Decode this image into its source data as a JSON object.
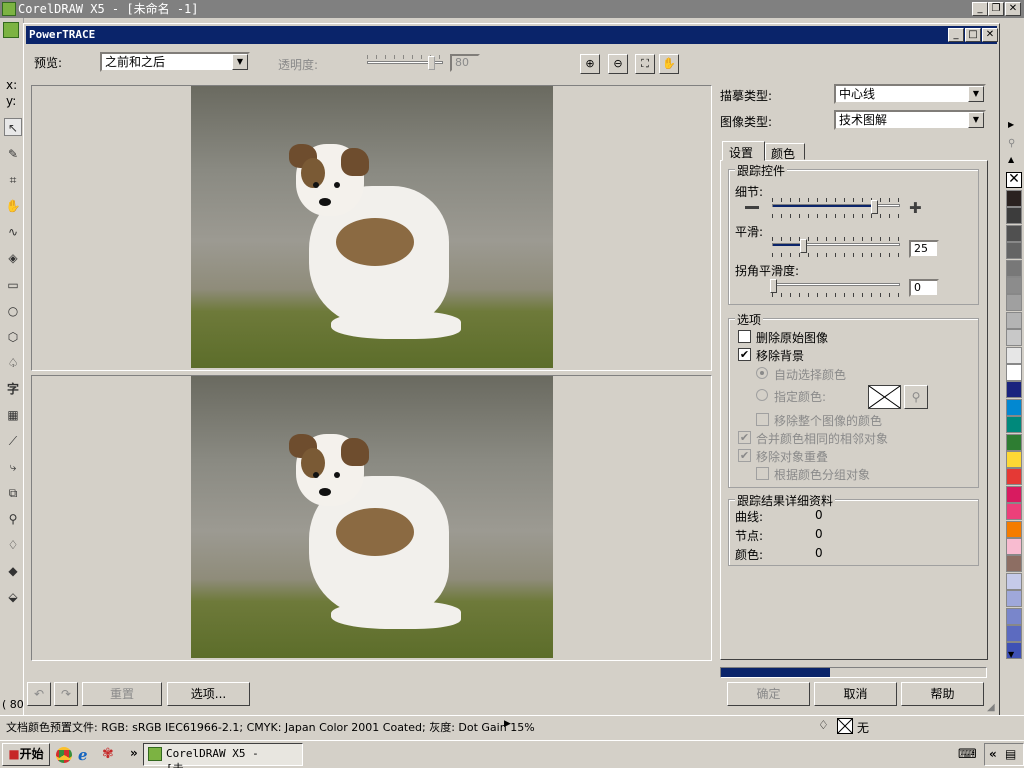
{
  "app": {
    "title": "CorelDRAW X5 - [未命名 -1]"
  },
  "left_panel": {
    "x_label": "x:",
    "y_label": "y:",
    "zoom_value": "( 80"
  },
  "dialog": {
    "title": "PowerTRACE",
    "preview_label": "预览:",
    "preview_value": "之前和之后",
    "transparency_label": "透明度:",
    "transparency_value": "80",
    "trace_type_label": "描摹类型:",
    "trace_type_value": "中心线",
    "image_type_label": "图像类型:",
    "image_type_value": "技术图解",
    "tabs": [
      "设置",
      "颜色"
    ],
    "trace_controls": {
      "title": "跟踪控件",
      "detail_label": "细节:",
      "detail_value": 0.82,
      "minus": "—",
      "plus": "✚",
      "smooth_label": "平滑:",
      "smooth_value": "25",
      "corner_label": "拐角平滑度:",
      "corner_value": "0"
    },
    "options": {
      "title": "选项",
      "delete_original": "删除原始图像",
      "remove_background": "移除背景",
      "auto_select_color": "自动选择颜色",
      "specify_color": "指定颜色:",
      "remove_color_from_entire_image": "移除整个图像的颜色",
      "merge_adjacent": "合并颜色相同的相邻对象",
      "remove_overlap": "移除对象重叠",
      "group_by_color": "根据颜色分组对象"
    },
    "details": {
      "title": "跟踪结果详细资料",
      "curves_label": "曲线:",
      "curves_value": "0",
      "nodes_label": "节点:",
      "nodes_value": "0",
      "colors_label": "颜色:",
      "colors_value": "0"
    },
    "progress": 0.41,
    "buttons": {
      "reset": "重置",
      "options": "选项...",
      "ok": "确定",
      "cancel": "取消",
      "help": "帮助"
    }
  },
  "statusbar": {
    "text": "文档颜色预置文件: RGB: sRGB IEC61966-2.1; CMYK: Japan Color 2001 Coated; 灰度: Dot Gain 15%",
    "fill_label": "无"
  },
  "taskbar": {
    "start_label": "开始",
    "task_label": "CorelDRAW X5 - [未...",
    "more": "»",
    "tray_more": "«"
  },
  "palette_colors": [
    "#2a2220",
    "#3c3c3c",
    "#505050",
    "#646464",
    "#787878",
    "#8c8c8c",
    "#a0a0a0",
    "#b4b4b4",
    "#c8c8c8",
    "#e6e6e6",
    "#ffffff",
    "#1a237e",
    "#0288d1",
    "#00897b",
    "#2e7d32",
    "#fdd835",
    "#e53935",
    "#d81b60",
    "#ec407a",
    "#f57c00",
    "#f8bbd0",
    "#8d6e63",
    "#c5cae9",
    "#9fa8da",
    "#7986cb",
    "#5c6bc0",
    "#3f51b5"
  ]
}
